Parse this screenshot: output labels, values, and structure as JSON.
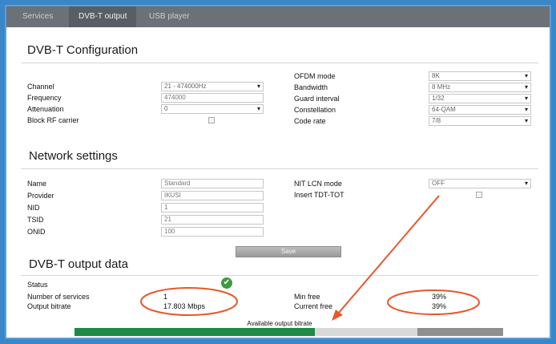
{
  "tabs": [
    "Services",
    "DVB-T output",
    "USB player"
  ],
  "dvbt_config": {
    "title": "DVB-T Configuration",
    "left": {
      "channel": {
        "label": "Channel",
        "value": "21 - 474000Hz"
      },
      "frequency": {
        "label": "Frequency",
        "value": "474000"
      },
      "attenuation": {
        "label": "Attenuation",
        "value": "0"
      },
      "block_rf": {
        "label": "Block RF carrier"
      }
    },
    "right": {
      "ofdm_mode": {
        "label": "OFDM mode",
        "value": "8K"
      },
      "bandwidth": {
        "label": "Bandwidth",
        "value": "8 MHz"
      },
      "guard_interval": {
        "label": "Guard interval",
        "value": "1/32"
      },
      "constellation": {
        "label": "Constellation",
        "value": "64-QAM"
      },
      "code_rate": {
        "label": "Code rate",
        "value": "7/8"
      }
    }
  },
  "network": {
    "title": "Network settings",
    "left": {
      "name": {
        "label": "Name",
        "value": "Standard"
      },
      "provider": {
        "label": "Provider",
        "value": "IKUSI"
      },
      "nid": {
        "label": "NID",
        "value": "1"
      },
      "tsid": {
        "label": "TSID",
        "value": "21"
      },
      "onid": {
        "label": "ONID",
        "value": "100"
      }
    },
    "right": {
      "nit_lcn_mode": {
        "label": "NIT LCN mode",
        "value": "OFF"
      },
      "insert_tdt_tot": {
        "label": "Insert TDT-TOT"
      }
    }
  },
  "save_label": "Save",
  "output": {
    "title": "DVB-T output data",
    "status_label": "Status",
    "num_services": {
      "label": "Number of services",
      "value": "1"
    },
    "output_bitrate": {
      "label": "Output bitrate",
      "value": "17.803 Mbps"
    },
    "min_free": {
      "label": "Min free",
      "value": "39%"
    },
    "current_free": {
      "label": "Current free",
      "value": "39%"
    },
    "bar_label": "Available output bitrate",
    "used_fraction": 0.56,
    "free_fraction": 0.2
  },
  "colors": {
    "tab_bar": "#6b7176",
    "bar_used": "#1e8a45",
    "bar_free": "#8f8f8f",
    "annotation": "#e8572c",
    "status_ok": "#3f9a3f"
  },
  "icons": {
    "status": "check-icon"
  }
}
